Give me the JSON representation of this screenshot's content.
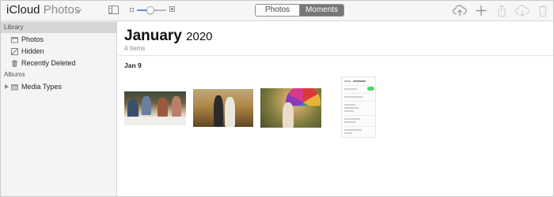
{
  "app": {
    "name_primary": "iCloud",
    "name_secondary": "Photos"
  },
  "toolbar": {
    "segmented": [
      {
        "label": "Photos",
        "active": false
      },
      {
        "label": "Moments",
        "active": true
      }
    ],
    "zoom_level": 0.45,
    "icons": [
      "upload-icon",
      "add-icon",
      "share-icon",
      "download-icon",
      "trash-icon"
    ]
  },
  "sidebar": {
    "library_header": "Library",
    "library_items": [
      {
        "label": "Photos",
        "icon": "photos-icon"
      },
      {
        "label": "Hidden",
        "icon": "hidden-icon"
      },
      {
        "label": "Recently Deleted",
        "icon": "trash-icon"
      }
    ],
    "albums_header": "Albums",
    "album_items": [
      {
        "label": "Media Types",
        "icon": "folder-icon"
      }
    ]
  },
  "main": {
    "month": "January",
    "year": "2020",
    "count": "4 Items",
    "day": "Jan 9",
    "photos": [
      {
        "name": "family-dinner-photo"
      },
      {
        "name": "couple-field-photo"
      },
      {
        "name": "woman-umbrella-photo"
      },
      {
        "name": "settings-screenshot"
      }
    ]
  },
  "colors": {
    "accent": "#5a8fd8",
    "segment_active": "#777777",
    "sidebar_bg": "#f4f4f4",
    "library_header_bg": "#d6d6d6"
  }
}
